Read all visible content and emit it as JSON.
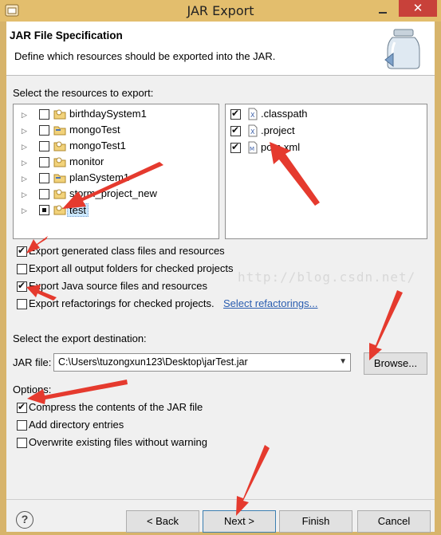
{
  "window": {
    "title": "JAR Export",
    "close_glyph": "✕"
  },
  "header": {
    "title": "JAR File Specification",
    "description": "Define which resources should be exported into the JAR."
  },
  "resources": {
    "label": "Select the resources to export:",
    "projects": [
      {
        "name": "birthdaySystem1",
        "checked": false,
        "icon": "java-project-icon"
      },
      {
        "name": "mongoTest",
        "checked": false,
        "icon": "folder-project-icon"
      },
      {
        "name": "mongoTest1",
        "checked": false,
        "icon": "java-project-icon"
      },
      {
        "name": "monitor",
        "checked": false,
        "icon": "java-project-icon"
      },
      {
        "name": "planSystem1",
        "checked": false,
        "icon": "folder-project-icon"
      },
      {
        "name": "storm_project_new",
        "checked": false,
        "icon": "java-project-icon"
      },
      {
        "name": "test",
        "checked": "partial",
        "icon": "java-project-icon",
        "selected": true
      }
    ],
    "files": [
      {
        "name": ".classpath",
        "checked": true,
        "icon": "xml-file-icon"
      },
      {
        "name": ".project",
        "checked": true,
        "icon": "xml-file-icon"
      },
      {
        "name": "pom.xml",
        "checked": true,
        "icon": "maven-file-icon"
      }
    ]
  },
  "options_export": {
    "generated_class": "Export generated class files and resources",
    "output_folders": "Export all output folders for checked projects",
    "java_source": "Export Java source files and resources",
    "refactorings": "Export refactorings for checked projects.",
    "select_refactorings": "Select refactorings..."
  },
  "destination": {
    "label": "Select the export destination:",
    "jar_label": "JAR file:",
    "jar_path": "C:\\Users\\tuzongxun123\\Desktop\\jarTest.jar",
    "browse": "Browse..."
  },
  "options": {
    "label": "Options:",
    "compress": "Compress the contents of the JAR file",
    "directory_entries": "Add directory entries",
    "overwrite": "Overwrite existing files without warning"
  },
  "buttons": {
    "help": "?",
    "back": "< Back",
    "next": "Next >",
    "finish": "Finish",
    "cancel": "Cancel"
  },
  "watermark": "http://blog.csdn.net/",
  "colors": {
    "accent": "#d7b46b",
    "annotation": "#e53a2e",
    "selection": "#cce8ff"
  }
}
